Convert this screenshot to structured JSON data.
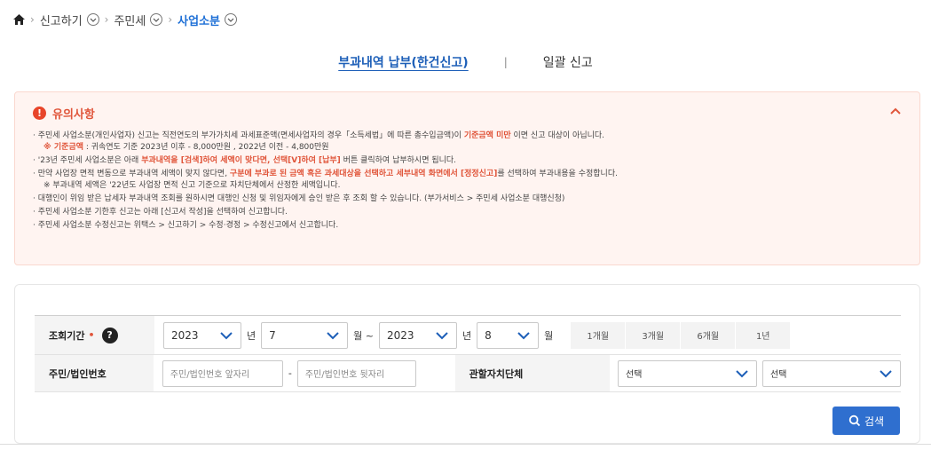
{
  "breadcrumb": {
    "items": [
      "신고하기",
      "주민세",
      "사업소분"
    ]
  },
  "tabs": {
    "active": "부과내역 납부(한건신고)",
    "divider": "|",
    "other": "일괄 신고"
  },
  "notice": {
    "title": "유의사항",
    "items": [
      {
        "prefix": "· 주민세 사업소분(개인사업자) 신고는 직전연도의 부가가치세 과세표준액(면세사업자의 경우「소득세법」에 따른 총수입금액)이 ",
        "em": "기준금액 미만",
        "suffix": " 이면 신고 대상이 아닙니다.",
        "sub_em": "※ 기준금액",
        "sub": " : 귀속연도 기준 2023년 이후 - 8,000만원 , 2022년 이전 - 4,800만원"
      },
      {
        "prefix": "· '23년 주민세 사업소분은 아래 ",
        "em": "부과내역을 [검색]하여 세액이 맞다면, 선택[V]하여 [납부]",
        "suffix": " 버튼 클릭하여 납부하시면 됩니다."
      },
      {
        "prefix": "· 만약 사업장 면적 변동으로 부과내역 세액이 맞지 않다면, ",
        "em": "구분에 부과로 된 금액 혹은 과세대상을 선택하고 세부내역 화면에서 [정정신고]",
        "suffix": "를 선택하여 부과내용을 수정합니다.",
        "sub": "※ 부과내역 세액은 '22년도 사업장 면적 신고 기준으로 자치단체에서 산정한 세액입니다."
      },
      {
        "prefix": "· 대행인이 위임 받은 납세자 부과내역 조회를 원하시면 대행인 신청 및 위임자에게 승인 받은 후 조회 할 수 있습니다. (부가서비스 > 주민세 사업소분 대행신청)"
      },
      {
        "prefix": "· 주민세 사업소분 기한후 신고는 아래 [신고서 작성]을 선택하여 신고합니다."
      },
      {
        "prefix": "· 주민세 사업소분 수정신고는 위택스 > 신고하기 > 수정·경정 > 수정신고에서 신고합니다."
      }
    ]
  },
  "form": {
    "period_label": "조회기간",
    "required_mark": "•",
    "help_glyph": "?",
    "from_year": "2023",
    "from_month": "7",
    "to_year": "2023",
    "to_month": "8",
    "year_unit": "년",
    "month_unit_from": "월 ~",
    "month_unit_to": "월",
    "period_buttons": [
      "1개월",
      "3개월",
      "6개월",
      "1년"
    ],
    "id_label": "주민/법인번호",
    "id_front_placeholder": "주민/법인번호 앞자리",
    "id_dash": "-",
    "id_back_placeholder": "주민/법인번호 뒷자리",
    "region_label": "관할자치단체",
    "region_select_1": "선택",
    "region_select_2": "선택",
    "search_label": "검색"
  },
  "colors": {
    "accent": "#1d6fd6",
    "warn": "#e0553a",
    "button": "#2f6fcf"
  }
}
